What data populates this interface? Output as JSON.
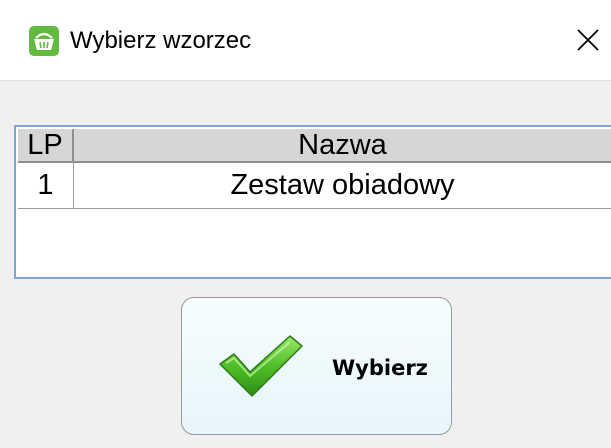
{
  "window": {
    "title": "Wybierz wzorzec",
    "icon": "basket-icon",
    "close_symbol": "✕"
  },
  "table": {
    "columns": [
      "LP",
      "Nazwa"
    ],
    "rows": [
      {
        "lp": "1",
        "nazwa": "Zestaw obiadowy"
      }
    ]
  },
  "select_button": {
    "label": "Wybierz",
    "icon": "check-icon"
  },
  "colors": {
    "accent_border": "#7ea7d8",
    "icon_green": "#5cb83c",
    "check_green": "#4caf2a"
  }
}
